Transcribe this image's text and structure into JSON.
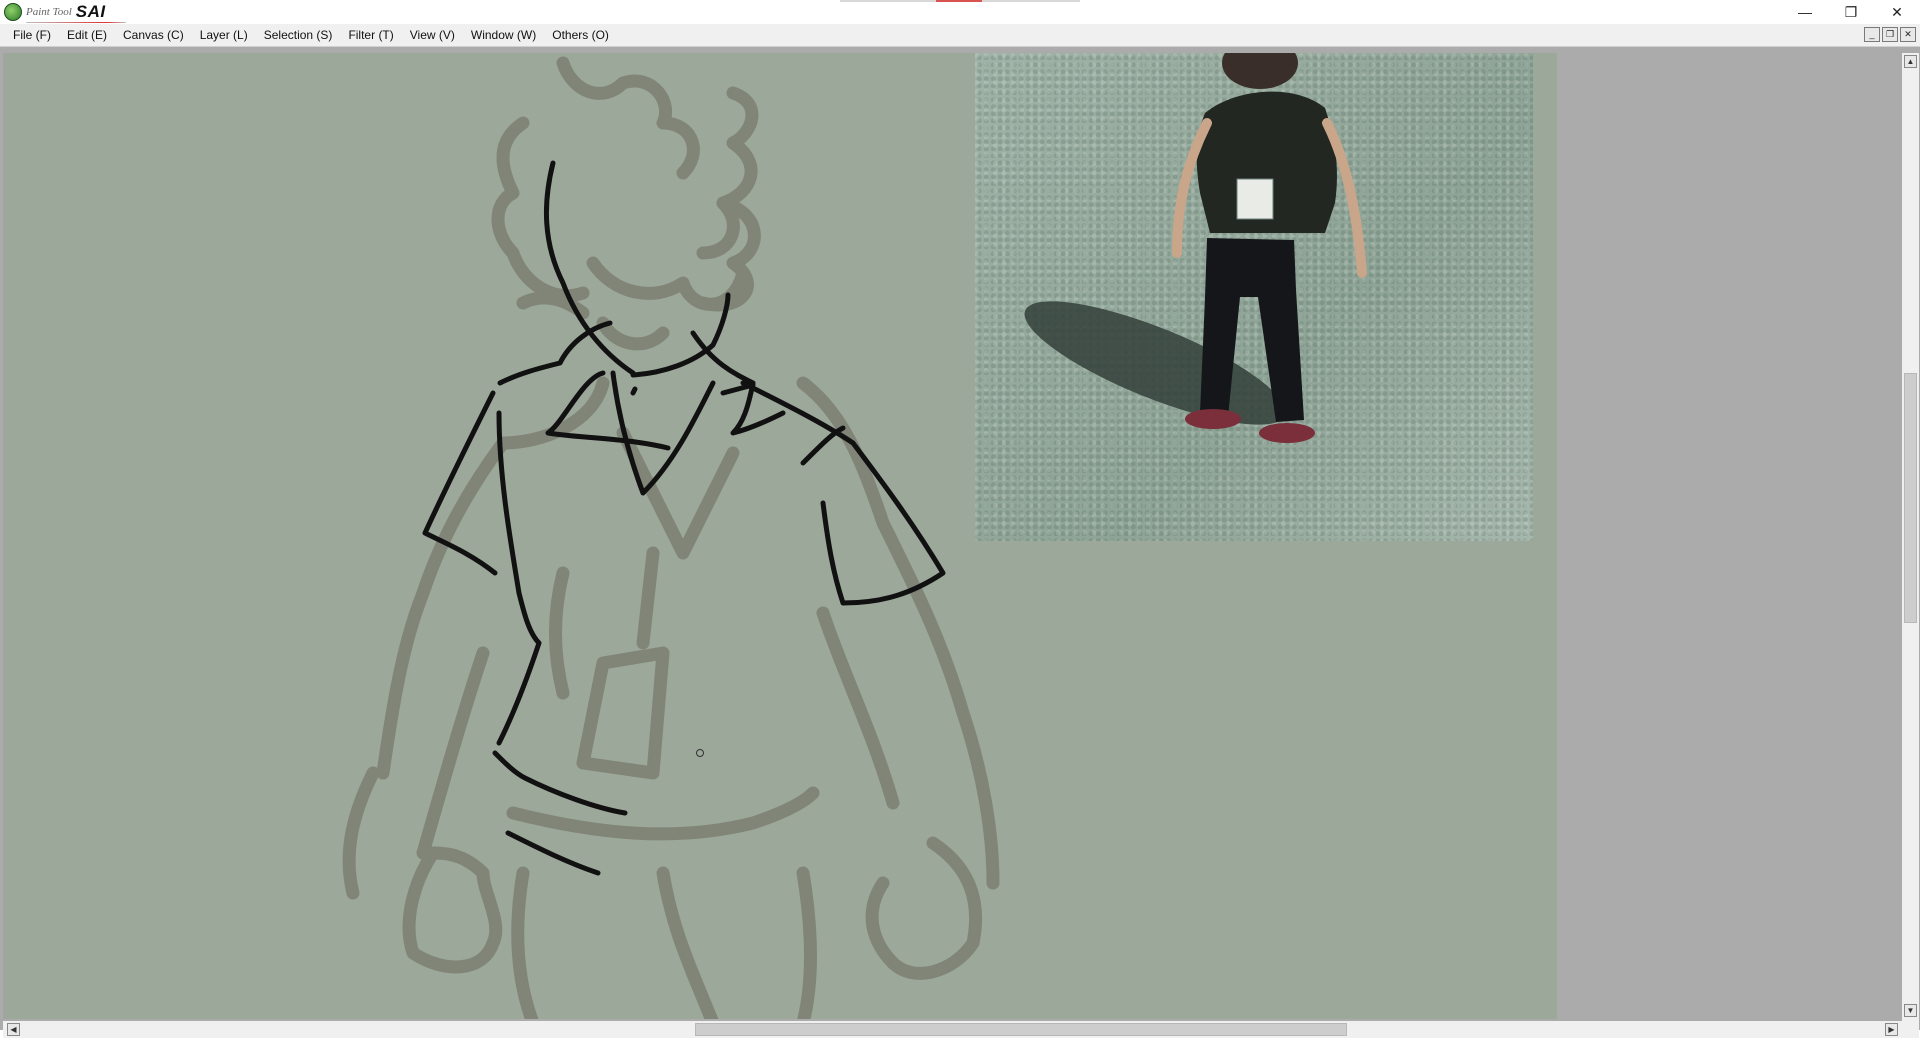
{
  "app": {
    "title_small": "Paint Tool",
    "title_big": "SAI"
  },
  "window_controls": {
    "minimize": "—",
    "restore": "❐",
    "close": "✕"
  },
  "menu": [
    {
      "label": "File (F)"
    },
    {
      "label": "Edit (E)"
    },
    {
      "label": "Canvas (C)"
    },
    {
      "label": "Layer (L)"
    },
    {
      "label": "Selection (S)"
    },
    {
      "label": "Filter (T)"
    },
    {
      "label": "View (V)"
    },
    {
      "label": "Window (W)"
    },
    {
      "label": "Others (O)"
    }
  ],
  "mdi_controls": {
    "minimize": "_",
    "restore": "❐",
    "close": "✕"
  },
  "colors": {
    "canvas_bg": "#9ca89a",
    "workspace_bg": "#ababab",
    "sketch_gray": "#7d7f72",
    "ink": "#111111"
  },
  "icons": {
    "app_logo": "paint-tool-sai-logo",
    "cursor": "brush-cursor-icon"
  }
}
